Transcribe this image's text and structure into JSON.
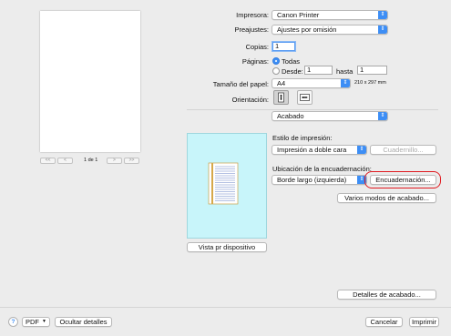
{
  "window": {
    "preview_page": "1 de 1",
    "nav": {
      "first": "<<",
      "prev": "<",
      "next": ">",
      "last": ">>"
    }
  },
  "printer": {
    "label": "Impresora:",
    "value": "Canon Printer"
  },
  "presets": {
    "label": "Preajustes:",
    "value": "Ajustes por omisión"
  },
  "copies": {
    "label": "Copias:",
    "value": "1"
  },
  "pages": {
    "label": "Páginas:",
    "all_label": "Todas",
    "from_label": "Desde:",
    "from_value": "1",
    "to_label": "hasta",
    "to_value": "1"
  },
  "paper_size": {
    "label": "Tamaño del papel:",
    "value": "A4",
    "dimensions": "210 x 297 mm"
  },
  "orientation": {
    "label": "Orientación:"
  },
  "section_popup": {
    "value": "Acabado"
  },
  "print_style": {
    "label": "Estilo de impresión:",
    "value": "Impresión a doble cara",
    "booklet_button": "Cuadernillo..."
  },
  "binding_location": {
    "label": "Ubicación de la encuadernación:",
    "value": "Borde largo (izquierda)",
    "binding_button": "Encuadernación...",
    "highlight_color": "#e0191f"
  },
  "finishing_modes_button": "Varios modos de acabado...",
  "device_view_button": "Vista pr dispositivo",
  "finishing_details_button": "Detalles de acabado...",
  "footer": {
    "help": "?",
    "pdf": "PDF",
    "hide_details": "Ocultar detalles",
    "cancel": "Cancelar",
    "print": "Imprimir"
  },
  "colors": {
    "accent": "#3d8ef5",
    "preview_bg": "#c8f5fa"
  }
}
